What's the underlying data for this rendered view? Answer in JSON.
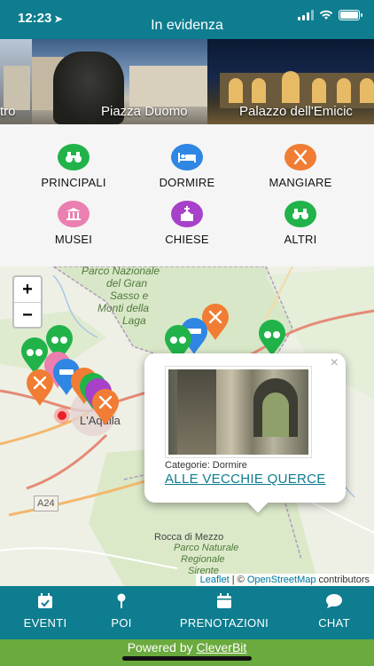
{
  "status": {
    "time": "12:23"
  },
  "header": {
    "title": "In evidenza"
  },
  "carousel": {
    "slides": [
      {
        "label": "tro"
      },
      {
        "label": "Piazza Duomo"
      },
      {
        "label": "Palazzo dell'Emicic"
      }
    ]
  },
  "categories": [
    {
      "label": "PRINCIPALI",
      "color": "#21b34a",
      "icon": "binoculars-icon"
    },
    {
      "label": "DORMIRE",
      "color": "#2f86e3",
      "icon": "bed-icon"
    },
    {
      "label": "MANGIARE",
      "color": "#f07d33",
      "icon": "fork-knife-icon"
    },
    {
      "label": "MUSEI",
      "color": "#ea7fb0",
      "icon": "museum-icon"
    },
    {
      "label": "CHIESE",
      "color": "#a841c9",
      "icon": "church-icon"
    },
    {
      "label": "ALTRI",
      "color": "#21b34a",
      "icon": "binoculars-icon"
    }
  ],
  "map": {
    "zoom_in": "+",
    "zoom_out": "−",
    "places": {
      "park1": "Parco Nazionale",
      "park2": "del Gran",
      "park3": "Sasso e",
      "park4": "Monti della",
      "park5": "Laga",
      "city": "L'Aquila",
      "road": "A24",
      "rocca": "Rocca di Mezzo",
      "park_r1": "Parco Naturale",
      "park_r2": "Regionale",
      "park_r3": "Sirente"
    },
    "popup": {
      "close": "×",
      "category": "Categorie: Dormire",
      "title": "ALLE VECCHIE QUERCE"
    },
    "attribution": {
      "leaflet": "Leaflet",
      "sep": " | © ",
      "osm": "OpenStreetMap",
      "contrib": " contributors"
    }
  },
  "tabs": [
    {
      "label": "EVENTI",
      "icon": "calendar-check-icon"
    },
    {
      "label": "POI",
      "icon": "map-pin-icon"
    },
    {
      "label": "PRENOTAZIONI",
      "icon": "calendar-icon"
    },
    {
      "label": "CHAT",
      "icon": "chat-bubble-icon"
    }
  ],
  "footer": {
    "powered": "Powered by ",
    "brand": "CleverBit"
  }
}
